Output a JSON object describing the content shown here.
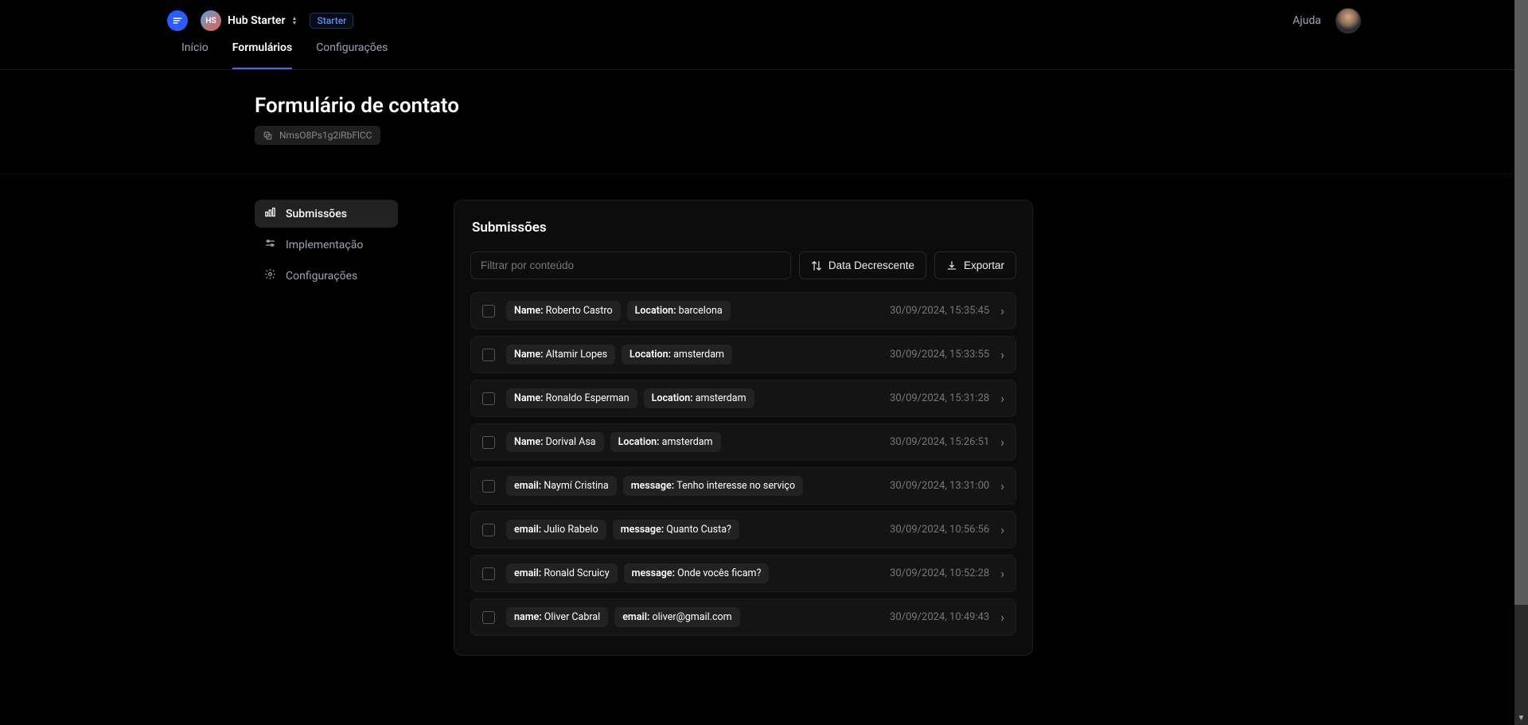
{
  "topbar": {
    "workspace_initials": "HS",
    "workspace_name": "Hub Starter",
    "plan_label": "Starter",
    "help_label": "Ajuda"
  },
  "nav": {
    "tabs": [
      {
        "label": "Início",
        "active": false
      },
      {
        "label": "Formulários",
        "active": true
      },
      {
        "label": "Configurações",
        "active": false
      }
    ]
  },
  "page": {
    "title": "Formulário de contato",
    "form_id": "NmsO8Ps1g2iRbFlCC"
  },
  "sidebar": {
    "items": [
      {
        "label": "Submissões",
        "active": true
      },
      {
        "label": "Implementação",
        "active": false
      },
      {
        "label": "Configurações",
        "active": false
      }
    ]
  },
  "content": {
    "title": "Submissões",
    "filter_placeholder": "Filtrar por conteúdo",
    "sort_label": "Data Decrescente",
    "export_label": "Exportar"
  },
  "submissions": [
    {
      "fields": [
        {
          "k": "Name",
          "v": "Roberto Castro"
        },
        {
          "k": "Location",
          "v": "barcelona"
        }
      ],
      "ts": "30/09/2024, 15:35:45"
    },
    {
      "fields": [
        {
          "k": "Name",
          "v": "Altamir Lopes"
        },
        {
          "k": "Location",
          "v": "amsterdam"
        }
      ],
      "ts": "30/09/2024, 15:33:55"
    },
    {
      "fields": [
        {
          "k": "Name",
          "v": "Ronaldo Esperman"
        },
        {
          "k": "Location",
          "v": "amsterdam"
        }
      ],
      "ts": "30/09/2024, 15:31:28"
    },
    {
      "fields": [
        {
          "k": "Name",
          "v": "Dorival Asa"
        },
        {
          "k": "Location",
          "v": "amsterdam"
        }
      ],
      "ts": "30/09/2024, 15:26:51"
    },
    {
      "fields": [
        {
          "k": "email",
          "v": "Naymí Cristina"
        },
        {
          "k": "message",
          "v": "Tenho interesse no serviço"
        }
      ],
      "ts": "30/09/2024, 13:31:00"
    },
    {
      "fields": [
        {
          "k": "email",
          "v": "Julio Rabelo"
        },
        {
          "k": "message",
          "v": "Quanto Custa?"
        }
      ],
      "ts": "30/09/2024, 10:56:56"
    },
    {
      "fields": [
        {
          "k": "email",
          "v": "Ronald Scruicy"
        },
        {
          "k": "message",
          "v": "Onde vocês ficam?"
        }
      ],
      "ts": "30/09/2024, 10:52:28"
    },
    {
      "fields": [
        {
          "k": "name",
          "v": "Oliver Cabral"
        },
        {
          "k": "email",
          "v": "oliver@gmail.com"
        }
      ],
      "ts": "30/09/2024, 10:49:43"
    }
  ]
}
